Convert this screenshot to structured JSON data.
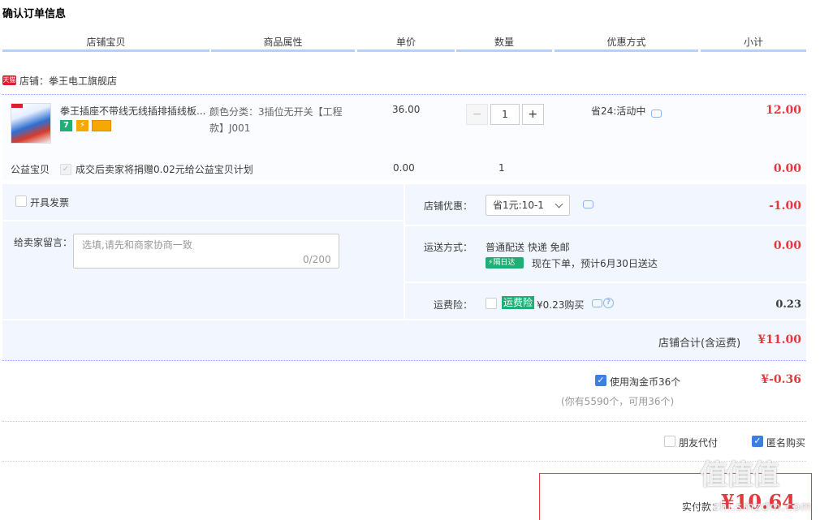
{
  "page_title": "确认订单信息",
  "columns": [
    "店铺宝贝",
    "商品属性",
    "单价",
    "数量",
    "优惠方式",
    "小计"
  ],
  "shop": {
    "badge": "天猫",
    "label": "店铺：拳王电工旗舰店"
  },
  "item": {
    "name": "拳王插座不带线无线插排插线板...",
    "badge_7": "7",
    "attr_line1": "颜色分类：3插位无开关【工程",
    "attr_line2": "款】J001",
    "price": "36.00",
    "qty_minus": "−",
    "qty": "1",
    "qty_plus": "+",
    "promo": "省24:活动中",
    "subtotal": "12.00"
  },
  "charity": {
    "label": "公益宝贝",
    "checkbox": "✓",
    "text": "成交后卖家将捐赠0.02元给公益宝贝计划",
    "price": "0.00",
    "qty": "1",
    "subtotal": "0.00"
  },
  "invoice": {
    "label": "开具发票"
  },
  "memo": {
    "label": "给卖家留言：",
    "placeholder": "选填,请先和商家协商一致",
    "count": "0/200"
  },
  "shop_discount": {
    "label": "店铺优惠：",
    "selected": "省1元:10-1",
    "amount": "-1.00"
  },
  "shipping": {
    "label": "运送方式：",
    "method": "普通配送 快递 免邮",
    "badge": "隔日达",
    "eta": "现在下单，预计6月30日送达",
    "amount": "0.00"
  },
  "insurance": {
    "label": "运费险：",
    "tag": "运费险",
    "price": "¥0.23购买",
    "help": "?",
    "amount": "0.23"
  },
  "shop_total": {
    "label": "店铺合计(含运费)",
    "amount": "¥11.00"
  },
  "coins": {
    "checkbox": "✓",
    "label": "使用淘金币36个",
    "note": "(你有5590个，可用36个)",
    "amount": "¥-0.36"
  },
  "options": {
    "friend_pay": "朋友代付",
    "anonymous_check": "✓",
    "anonymous": "匿名购买"
  },
  "payment": {
    "label": "实付款：",
    "amount": "¥10.64"
  },
  "watermark": {
    "big": "值值值",
    "small": "zhi.smzdm.com"
  },
  "colors": {
    "accent_red": "#e4393c",
    "panel_blue": "#f2f7ff",
    "header_line": "#b2d1ff",
    "check_blue": "#3d7ee4",
    "green": "#1fae76"
  }
}
